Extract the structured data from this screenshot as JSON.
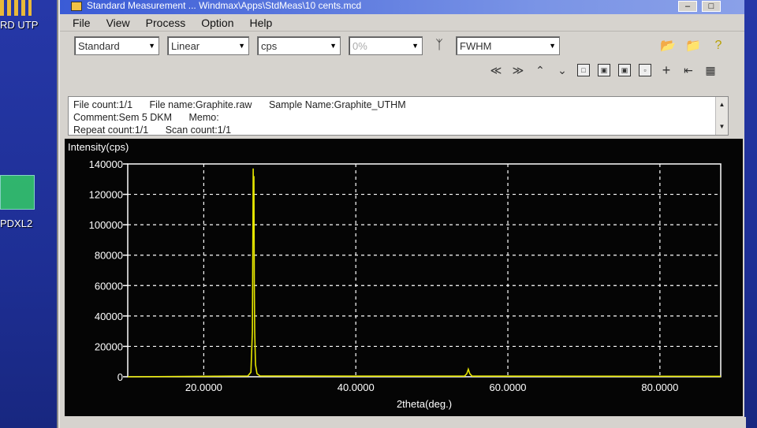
{
  "desktop": {
    "icons": [
      {
        "label": "RD UTP"
      },
      {
        "label": "PDXL2"
      }
    ]
  },
  "window": {
    "title": "Standard Measurement ... Windmax\\Apps\\StdMeas\\10 cents.mcd"
  },
  "menu": [
    "File",
    "View",
    "Process",
    "Option",
    "Help"
  ],
  "toolbar": {
    "mode": "Standard",
    "scale": "Linear",
    "unit": "cps",
    "percent": "0%",
    "peak": "FWHM"
  },
  "info": {
    "file_count": "File count:1/1",
    "file_name": "File name:Graphite.raw",
    "sample_name": "Sample Name:Graphite_UTHM",
    "comment": "Comment:Sem 5 DKM",
    "memo": "Memo:",
    "repeat_count": "Repeat count:1/1",
    "scan_count": "Scan count:1/1"
  },
  "colors": {
    "series": "#e6e600",
    "axis": "#ffffff",
    "grid": "#ffffff",
    "plot_bg": "#050505"
  },
  "chart_data": {
    "type": "line",
    "title": "",
    "ylabel": "Intensity(cps)",
    "xlabel": "2theta(deg.)",
    "xlim": [
      10,
      88
    ],
    "ylim": [
      0,
      140000
    ],
    "xticks": [
      20,
      40,
      60,
      80
    ],
    "xtick_labels": [
      "20.0000",
      "40.0000",
      "60.0000",
      "80.0000"
    ],
    "yticks": [
      0,
      20000,
      40000,
      60000,
      80000,
      100000,
      120000,
      140000
    ],
    "ytick_labels": [
      "0",
      "20000",
      "40000",
      "60000",
      "80000",
      "100000",
      "120000",
      "140000"
    ],
    "grid": true,
    "series": [
      {
        "x": [
          10,
          25.8,
          26.2,
          26.4,
          26.5,
          26.55,
          26.6,
          26.65,
          26.7,
          26.8,
          27.0,
          27.4,
          40,
          54.3,
          54.6,
          54.8,
          55.0,
          55.3,
          88
        ],
        "y": [
          0,
          500,
          3000,
          30000,
          137000,
          100000,
          132000,
          60000,
          30000,
          8000,
          2000,
          500,
          400,
          400,
          2000,
          5000,
          2000,
          400,
          300
        ]
      }
    ]
  }
}
